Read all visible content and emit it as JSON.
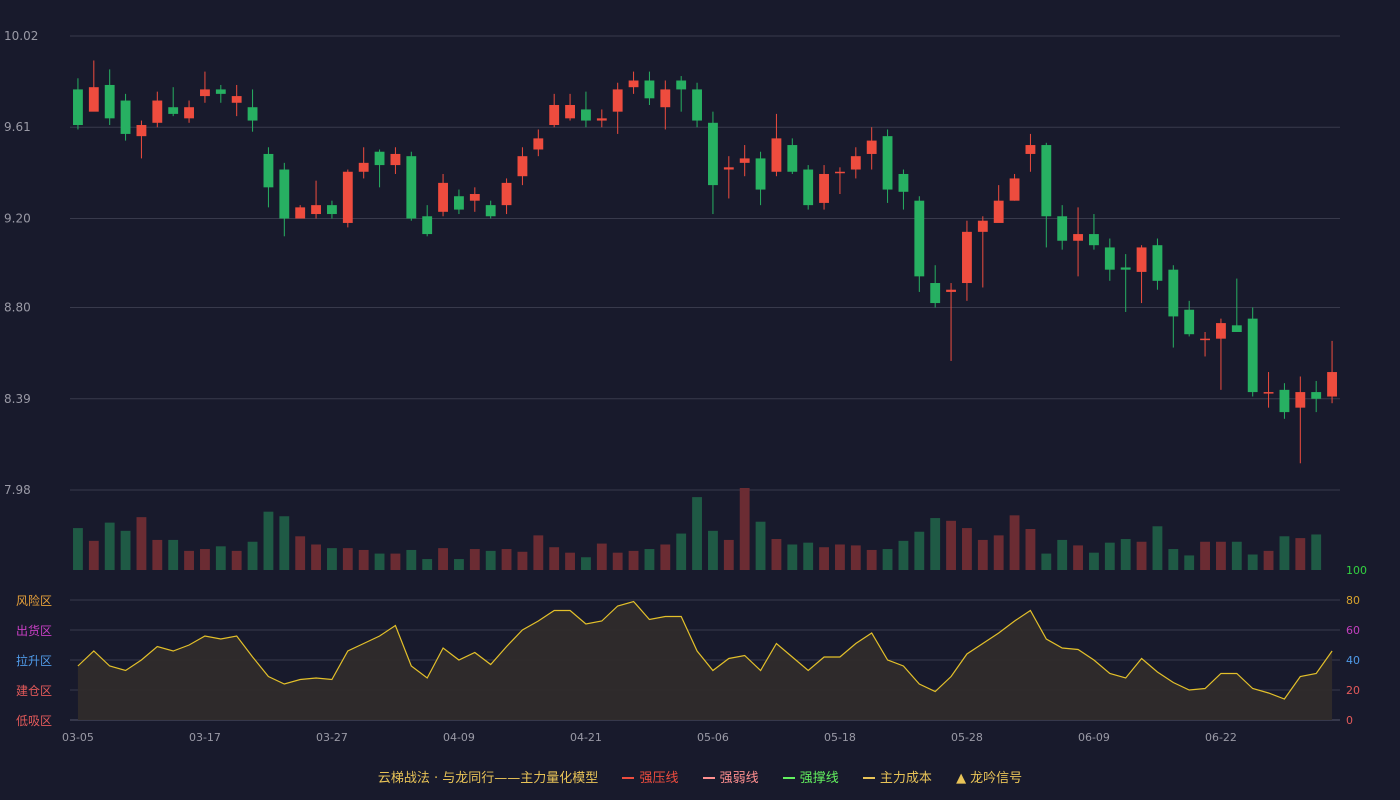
{
  "colors": {
    "background": "#181a2c",
    "up": "#ee4c3e",
    "down": "#27b062",
    "vol_up": "#6b2c33",
    "vol_down": "#1f5a45",
    "grid": "#383a4c",
    "axis_text": "#9a9aa6",
    "osc_line": "#e3c02a",
    "osc_fill": "#2f2b2b"
  },
  "legend": {
    "title": "云梯战法 · 与龙同行——主力量化模型",
    "items": [
      {
        "label": "强压线",
        "color": "#ee4c3e",
        "style": "solid"
      },
      {
        "label": "强弱线",
        "color": "#ff8f8f",
        "style": "dashed"
      },
      {
        "label": "强撑线",
        "color": "#62f05e",
        "style": "solid"
      },
      {
        "label": "主力成本",
        "color": "#e8c357",
        "style": "dashed"
      },
      {
        "label": "龙吟信号",
        "color": "#e8c357",
        "style": "triangle",
        "glyph": "▲"
      }
    ]
  },
  "chart_data": {
    "type": "candlestick",
    "y_ticks": [
      "10.02",
      "9.61",
      "9.20",
      "8.80",
      "8.39",
      "7.98"
    ],
    "ylim": [
      7.98,
      10.02
    ],
    "x_tick_labels": [
      {
        "index": 0,
        "label": "03-05"
      },
      {
        "index": 8,
        "label": "03-17"
      },
      {
        "index": 16,
        "label": "03-27"
      },
      {
        "index": 24,
        "label": "04-09"
      },
      {
        "index": 32,
        "label": "04-21"
      },
      {
        "index": 40,
        "label": "05-06"
      },
      {
        "index": 48,
        "label": "05-18"
      },
      {
        "index": 56,
        "label": "05-28"
      },
      {
        "index": 64,
        "label": "06-09"
      },
      {
        "index": 72,
        "label": "06-22"
      }
    ],
    "candles": [
      [
        9.78,
        9.62,
        9.83,
        9.6
      ],
      [
        9.68,
        9.79,
        9.91,
        9.72
      ],
      [
        9.8,
        9.65,
        9.87,
        9.62
      ],
      [
        9.73,
        9.58,
        9.76,
        9.55
      ],
      [
        9.57,
        9.62,
        9.64,
        9.47
      ],
      [
        9.63,
        9.73,
        9.77,
        9.61
      ],
      [
        9.7,
        9.67,
        9.79,
        9.66
      ],
      [
        9.65,
        9.7,
        9.73,
        9.63
      ],
      [
        9.75,
        9.78,
        9.86,
        9.72
      ],
      [
        9.78,
        9.76,
        9.8,
        9.72
      ],
      [
        9.72,
        9.75,
        9.8,
        9.66
      ],
      [
        9.7,
        9.64,
        9.78,
        9.59
      ],
      [
        9.49,
        9.34,
        9.52,
        9.25
      ],
      [
        9.42,
        9.2,
        9.45,
        9.12
      ],
      [
        9.2,
        9.25,
        9.26,
        9.2
      ],
      [
        9.22,
        9.26,
        9.37,
        9.2
      ],
      [
        9.26,
        9.22,
        9.28,
        9.2
      ],
      [
        9.18,
        9.41,
        9.42,
        9.16
      ],
      [
        9.41,
        9.45,
        9.52,
        9.38
      ],
      [
        9.5,
        9.44,
        9.51,
        9.34
      ],
      [
        9.44,
        9.49,
        9.52,
        9.4
      ],
      [
        9.48,
        9.2,
        9.5,
        9.19
      ],
      [
        9.21,
        9.13,
        9.26,
        9.12
      ],
      [
        9.23,
        9.36,
        9.4,
        9.21
      ],
      [
        9.3,
        9.24,
        9.33,
        9.22
      ],
      [
        9.28,
        9.31,
        9.34,
        9.23
      ],
      [
        9.26,
        9.21,
        9.28,
        9.2
      ],
      [
        9.26,
        9.36,
        9.38,
        9.22
      ],
      [
        9.39,
        9.48,
        9.52,
        9.35
      ],
      [
        9.51,
        9.56,
        9.6,
        9.48
      ],
      [
        9.62,
        9.71,
        9.76,
        9.61
      ],
      [
        9.65,
        9.71,
        9.76,
        9.64
      ],
      [
        9.69,
        9.64,
        9.77,
        9.61
      ],
      [
        9.64,
        9.65,
        9.69,
        9.61
      ],
      [
        9.68,
        9.78,
        9.81,
        9.58
      ],
      [
        9.79,
        9.82,
        9.86,
        9.76
      ],
      [
        9.82,
        9.74,
        9.86,
        9.71
      ],
      [
        9.7,
        9.78,
        9.82,
        9.6
      ],
      [
        9.82,
        9.78,
        9.84,
        9.68
      ],
      [
        9.78,
        9.64,
        9.81,
        9.61
      ],
      [
        9.63,
        9.35,
        9.68,
        9.22
      ],
      [
        9.42,
        9.43,
        9.48,
        9.29
      ],
      [
        9.45,
        9.47,
        9.53,
        9.39
      ],
      [
        9.47,
        9.33,
        9.5,
        9.26
      ],
      [
        9.41,
        9.56,
        9.67,
        9.39
      ],
      [
        9.53,
        9.41,
        9.56,
        9.4
      ],
      [
        9.42,
        9.26,
        9.44,
        9.24
      ],
      [
        9.27,
        9.4,
        9.44,
        9.24
      ],
      [
        9.41,
        9.41,
        9.43,
        9.31
      ],
      [
        9.42,
        9.48,
        9.52,
        9.38
      ],
      [
        9.49,
        9.55,
        9.61,
        9.42
      ],
      [
        9.57,
        9.33,
        9.6,
        9.27
      ],
      [
        9.4,
        9.32,
        9.42,
        9.24
      ],
      [
        9.28,
        8.94,
        9.3,
        8.87
      ],
      [
        8.91,
        8.82,
        8.99,
        8.8
      ],
      [
        8.87,
        8.88,
        8.91,
        8.56
      ],
      [
        8.91,
        9.14,
        9.19,
        8.83
      ],
      [
        9.14,
        9.19,
        9.21,
        8.89
      ],
      [
        9.18,
        9.28,
        9.35,
        9.21
      ],
      [
        9.28,
        9.38,
        9.4,
        9.28
      ],
      [
        9.49,
        9.53,
        9.58,
        9.41
      ],
      [
        9.53,
        9.21,
        9.54,
        9.07
      ],
      [
        9.21,
        9.1,
        9.26,
        9.06
      ],
      [
        9.1,
        9.13,
        9.25,
        8.94
      ],
      [
        9.13,
        9.08,
        9.22,
        9.06
      ],
      [
        9.07,
        8.97,
        9.11,
        8.92
      ],
      [
        8.98,
        8.97,
        9.04,
        8.78
      ],
      [
        8.96,
        9.07,
        9.08,
        8.82
      ],
      [
        9.08,
        8.92,
        9.11,
        8.88
      ],
      [
        8.97,
        8.76,
        8.99,
        8.62
      ],
      [
        8.79,
        8.68,
        8.83,
        8.67
      ],
      [
        8.66,
        8.66,
        8.69,
        8.58
      ],
      [
        8.66,
        8.73,
        8.75,
        8.43
      ],
      [
        8.72,
        8.69,
        8.93,
        8.69
      ],
      [
        8.75,
        8.42,
        8.8,
        8.4
      ],
      [
        8.42,
        8.42,
        8.51,
        8.35
      ],
      [
        8.43,
        8.33,
        8.46,
        8.3
      ],
      [
        8.35,
        8.42,
        8.49,
        8.1
      ],
      [
        8.42,
        8.39,
        8.47,
        8.33
      ],
      [
        8.4,
        8.51,
        8.65,
        8.37
      ]
    ],
    "volume": {
      "values": [
        46,
        32,
        52,
        43,
        58,
        33,
        33,
        21,
        23,
        26,
        21,
        31,
        64,
        59,
        37,
        28,
        24,
        24,
        22,
        18,
        18,
        22,
        12,
        24,
        12,
        23,
        21,
        23,
        20,
        38,
        25,
        19,
        14,
        29,
        19,
        21,
        23,
        28,
        40,
        80,
        43,
        33,
        90,
        53,
        34,
        28,
        30,
        25,
        28,
        27,
        22,
        23,
        32,
        42,
        57,
        54,
        46,
        33,
        38,
        60,
        45,
        18,
        33,
        27,
        19,
        30,
        34,
        31,
        48,
        23,
        16,
        31,
        31,
        31,
        17,
        21,
        37,
        35,
        39
      ],
      "max": 90
    },
    "oscillator": {
      "y_ticks": [
        {
          "value": 100,
          "label": "100",
          "color": "#32d240"
        },
        {
          "value": 80,
          "label": "80",
          "color": "#d8a32c"
        },
        {
          "value": 60,
          "label": "60",
          "color": "#c43fbf"
        },
        {
          "value": 40,
          "label": "40",
          "color": "#4f9ae8"
        },
        {
          "value": 20,
          "label": "20",
          "color": "#e35a5a"
        },
        {
          "value": 0,
          "label": "0",
          "color": "#e35a5a"
        }
      ],
      "zones": [
        {
          "value": 80,
          "label": "风险区",
          "color": "#e8a13a"
        },
        {
          "value": 60,
          "label": "出货区",
          "color": "#c83fc4"
        },
        {
          "value": 40,
          "label": "拉升区",
          "color": "#4f9ae8"
        },
        {
          "value": 20,
          "label": "建仓区",
          "color": "#e35a5a"
        },
        {
          "value": 0,
          "label": "低吸区",
          "color": "#e35a5a"
        }
      ],
      "values": [
        36,
        46,
        36,
        33,
        40,
        49,
        46,
        50,
        56,
        54,
        56,
        42,
        29,
        24,
        27,
        28,
        27,
        46,
        51,
        56,
        63,
        36,
        28,
        48,
        40,
        45,
        37,
        49,
        60,
        66,
        73,
        73,
        64,
        66,
        76,
        79,
        67,
        69,
        69,
        46,
        33,
        41,
        43,
        33,
        51,
        42,
        33,
        42,
        42,
        51,
        58,
        40,
        36,
        24,
        19,
        29,
        44,
        51,
        58,
        66,
        73,
        54,
        48,
        47,
        40,
        31,
        28,
        41,
        32,
        25,
        20,
        21,
        31,
        31,
        21,
        18,
        14,
        29,
        31,
        46
      ]
    }
  }
}
